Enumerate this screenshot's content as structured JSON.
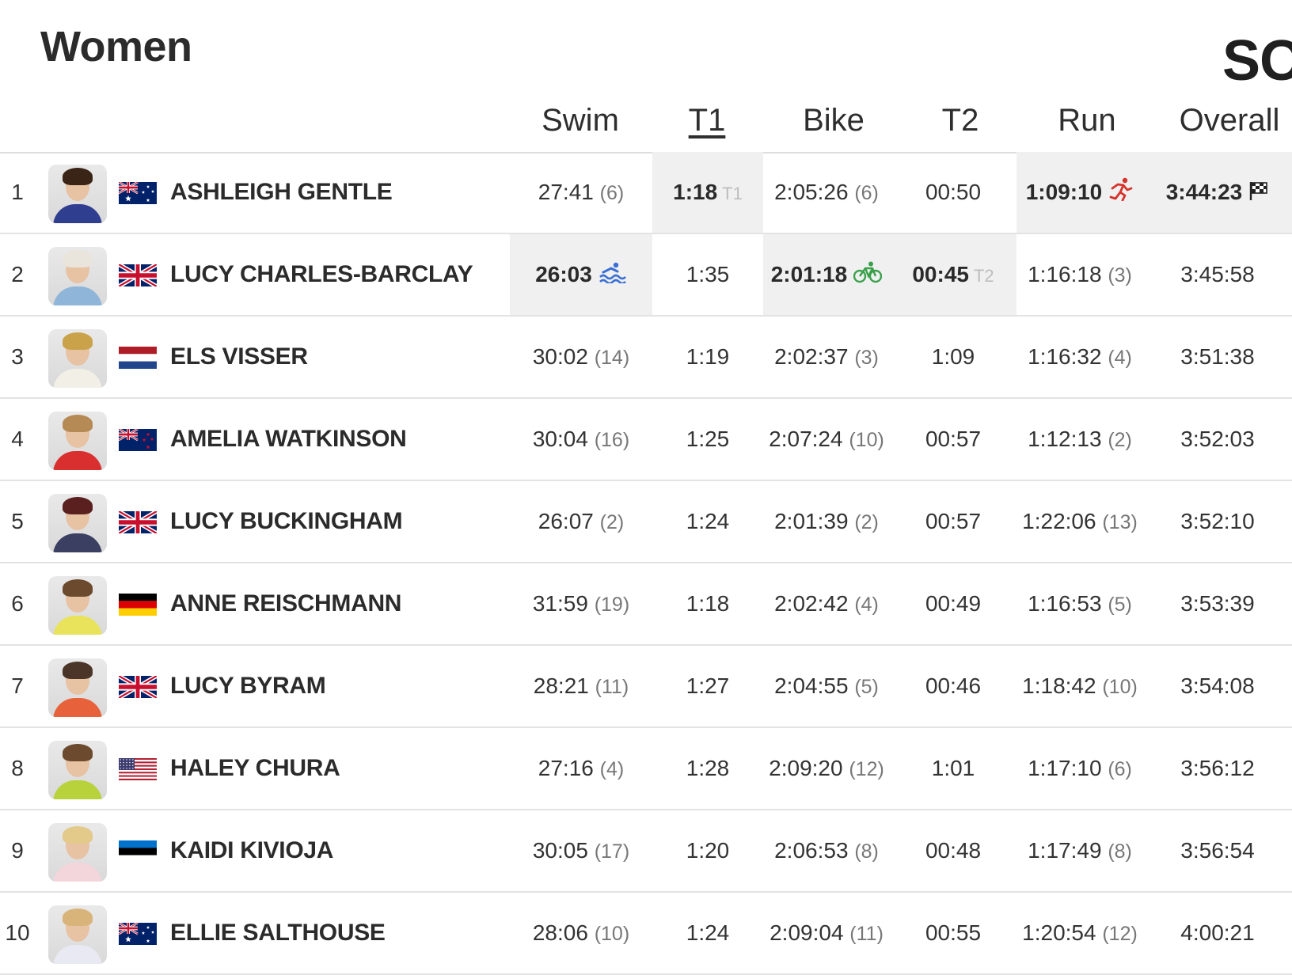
{
  "page": {
    "title": "Women",
    "right_cut_text": "SO"
  },
  "columns": [
    {
      "key": "swim",
      "label": "Swim"
    },
    {
      "key": "t1",
      "label": "T1"
    },
    {
      "key": "bike",
      "label": "Bike"
    },
    {
      "key": "t2",
      "label": "T2"
    },
    {
      "key": "run",
      "label": "Run"
    },
    {
      "key": "overall",
      "label": "Overall"
    }
  ],
  "rows": [
    {
      "rank": "1",
      "name": "ASHLEIGH GENTLE",
      "flag": "australia-flag",
      "swim": {
        "time": "27:41",
        "place": "(6)"
      },
      "t1": {
        "time": "1:18",
        "tag": "T1",
        "best": true
      },
      "bike": {
        "time": "2:05:26",
        "place": "(6)"
      },
      "t2": {
        "time": "00:50"
      },
      "run": {
        "time": "1:09:10",
        "best": true,
        "icon": "run-icon"
      },
      "overall": {
        "time": "3:44:23",
        "best": true,
        "icon": "finish-flag-icon"
      }
    },
    {
      "rank": "2",
      "name": "LUCY CHARLES-BARCLAY",
      "flag": "uk-flag",
      "swim": {
        "time": "26:03",
        "best": true,
        "icon": "swim-icon"
      },
      "t1": {
        "time": "1:35"
      },
      "bike": {
        "time": "2:01:18",
        "best": true,
        "icon": "bike-icon"
      },
      "t2": {
        "time": "00:45",
        "tag": "T2",
        "best": true
      },
      "run": {
        "time": "1:16:18",
        "place": "(3)"
      },
      "overall": {
        "time": "3:45:58"
      }
    },
    {
      "rank": "3",
      "name": "ELS VISSER",
      "flag": "netherlands-flag",
      "swim": {
        "time": "30:02",
        "place": "(14)"
      },
      "t1": {
        "time": "1:19"
      },
      "bike": {
        "time": "2:02:37",
        "place": "(3)"
      },
      "t2": {
        "time": "1:09"
      },
      "run": {
        "time": "1:16:32",
        "place": "(4)"
      },
      "overall": {
        "time": "3:51:38"
      }
    },
    {
      "rank": "4",
      "name": "AMELIA WATKINSON",
      "flag": "new-zealand-flag",
      "swim": {
        "time": "30:04",
        "place": "(16)"
      },
      "t1": {
        "time": "1:25"
      },
      "bike": {
        "time": "2:07:24",
        "place": "(10)"
      },
      "t2": {
        "time": "00:57"
      },
      "run": {
        "time": "1:12:13",
        "place": "(2)"
      },
      "overall": {
        "time": "3:52:03"
      }
    },
    {
      "rank": "5",
      "name": "LUCY BUCKINGHAM",
      "flag": "uk-flag",
      "swim": {
        "time": "26:07",
        "place": "(2)"
      },
      "t1": {
        "time": "1:24"
      },
      "bike": {
        "time": "2:01:39",
        "place": "(2)"
      },
      "t2": {
        "time": "00:57"
      },
      "run": {
        "time": "1:22:06",
        "place": "(13)"
      },
      "overall": {
        "time": "3:52:10"
      }
    },
    {
      "rank": "6",
      "name": "ANNE REISCHMANN",
      "flag": "germany-flag",
      "swim": {
        "time": "31:59",
        "place": "(19)"
      },
      "t1": {
        "time": "1:18"
      },
      "bike": {
        "time": "2:02:42",
        "place": "(4)"
      },
      "t2": {
        "time": "00:49"
      },
      "run": {
        "time": "1:16:53",
        "place": "(5)"
      },
      "overall": {
        "time": "3:53:39"
      }
    },
    {
      "rank": "7",
      "name": "LUCY BYRAM",
      "flag": "uk-flag",
      "swim": {
        "time": "28:21",
        "place": "(11)"
      },
      "t1": {
        "time": "1:27"
      },
      "bike": {
        "time": "2:04:55",
        "place": "(5)"
      },
      "t2": {
        "time": "00:46"
      },
      "run": {
        "time": "1:18:42",
        "place": "(10)"
      },
      "overall": {
        "time": "3:54:08"
      }
    },
    {
      "rank": "8",
      "name": "HALEY CHURA",
      "flag": "usa-flag",
      "swim": {
        "time": "27:16",
        "place": "(4)"
      },
      "t1": {
        "time": "1:28"
      },
      "bike": {
        "time": "2:09:20",
        "place": "(12)"
      },
      "t2": {
        "time": "1:01"
      },
      "run": {
        "time": "1:17:10",
        "place": "(6)"
      },
      "overall": {
        "time": "3:56:12"
      }
    },
    {
      "rank": "9",
      "name": "KAIDI KIVIOJA",
      "flag": "estonia-flag",
      "swim": {
        "time": "30:05",
        "place": "(17)"
      },
      "t1": {
        "time": "1:20"
      },
      "bike": {
        "time": "2:06:53",
        "place": "(8)"
      },
      "t2": {
        "time": "00:48"
      },
      "run": {
        "time": "1:17:49",
        "place": "(8)"
      },
      "overall": {
        "time": "3:56:54"
      }
    },
    {
      "rank": "10",
      "name": "ELLIE SALTHOUSE",
      "flag": "australia-flag",
      "swim": {
        "time": "28:06",
        "place": "(10)"
      },
      "t1": {
        "time": "1:24"
      },
      "bike": {
        "time": "2:09:04",
        "place": "(11)"
      },
      "t2": {
        "time": "00:55"
      },
      "run": {
        "time": "1:20:54",
        "place": "(12)"
      },
      "overall": {
        "time": "4:00:21"
      }
    }
  ],
  "colors": {
    "highlight_bg": "#f0f0f0",
    "swim_icon": "#3b6fd4",
    "bike_icon": "#3aa04a",
    "run_icon": "#d6322a",
    "place_text": "#777777",
    "tag_text": "#bdbdbd"
  }
}
